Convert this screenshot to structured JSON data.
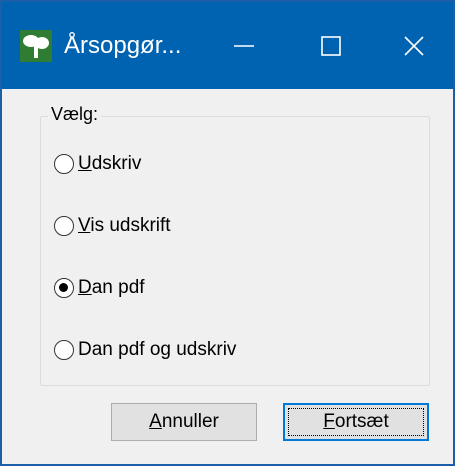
{
  "window": {
    "title": "Årsopgør...",
    "app_icon": "tree-app-icon",
    "controls": {
      "minimize_icon": "minimize-icon",
      "maximize_icon": "maximize-icon",
      "close_icon": "close-icon"
    }
  },
  "group": {
    "label": "Vælg:",
    "options": [
      {
        "label": "Udskriv",
        "selected": false
      },
      {
        "label": "Vis udskrift",
        "selected": false
      },
      {
        "label": "Dan pdf",
        "selected": true
      },
      {
        "label": "Dan pdf og udskriv",
        "selected": false
      }
    ]
  },
  "buttons": {
    "cancel_label": "Annuller",
    "continue_label": "Fortsæt"
  },
  "colors": {
    "titlebar": "#0063b1",
    "dialog_bg": "#f0f0f0",
    "focus_border": "#0078d7"
  }
}
